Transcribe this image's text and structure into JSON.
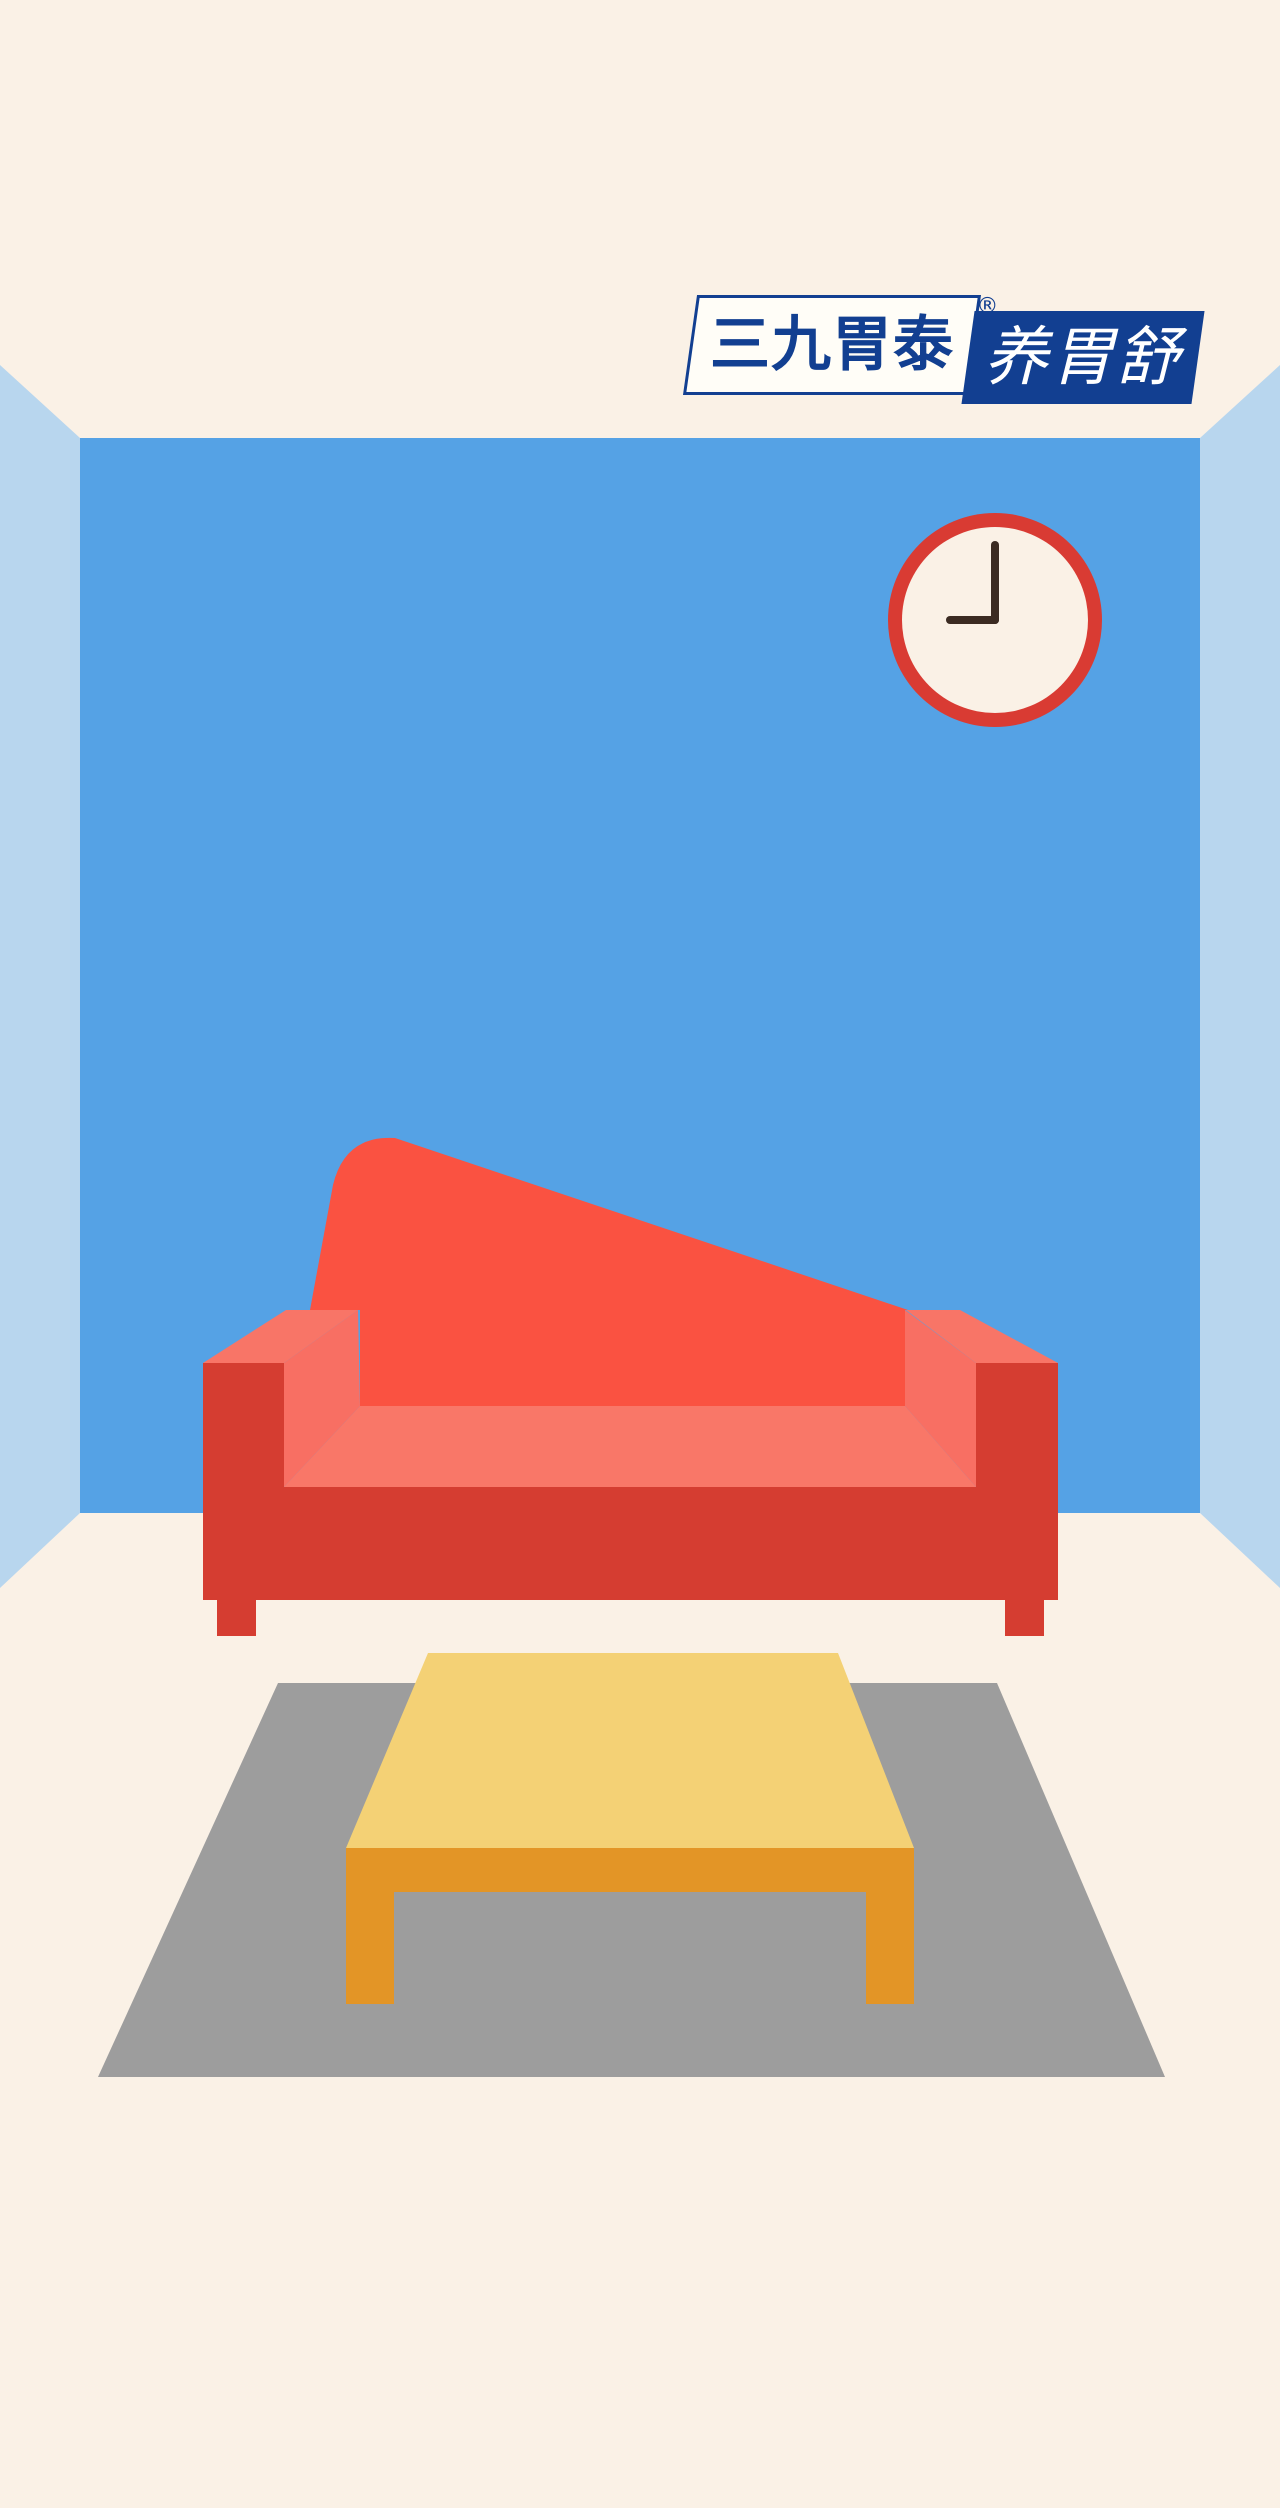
{
  "brand": {
    "name": "三九胃泰",
    "registered_mark": "®",
    "product": "养胃舒",
    "color": "#123f91"
  },
  "scene": {
    "wall_color": "#55a2e5",
    "side_wall_color": "#b8d6ee",
    "floor_color": "#faf1e6",
    "sofa_color": "#d53d31",
    "table_color": "#f4d175",
    "rug_color": "#9d9d9d"
  },
  "clock": {
    "time": "9:00",
    "hour": 9,
    "minute": 0,
    "rim_color": "#d93b33"
  }
}
